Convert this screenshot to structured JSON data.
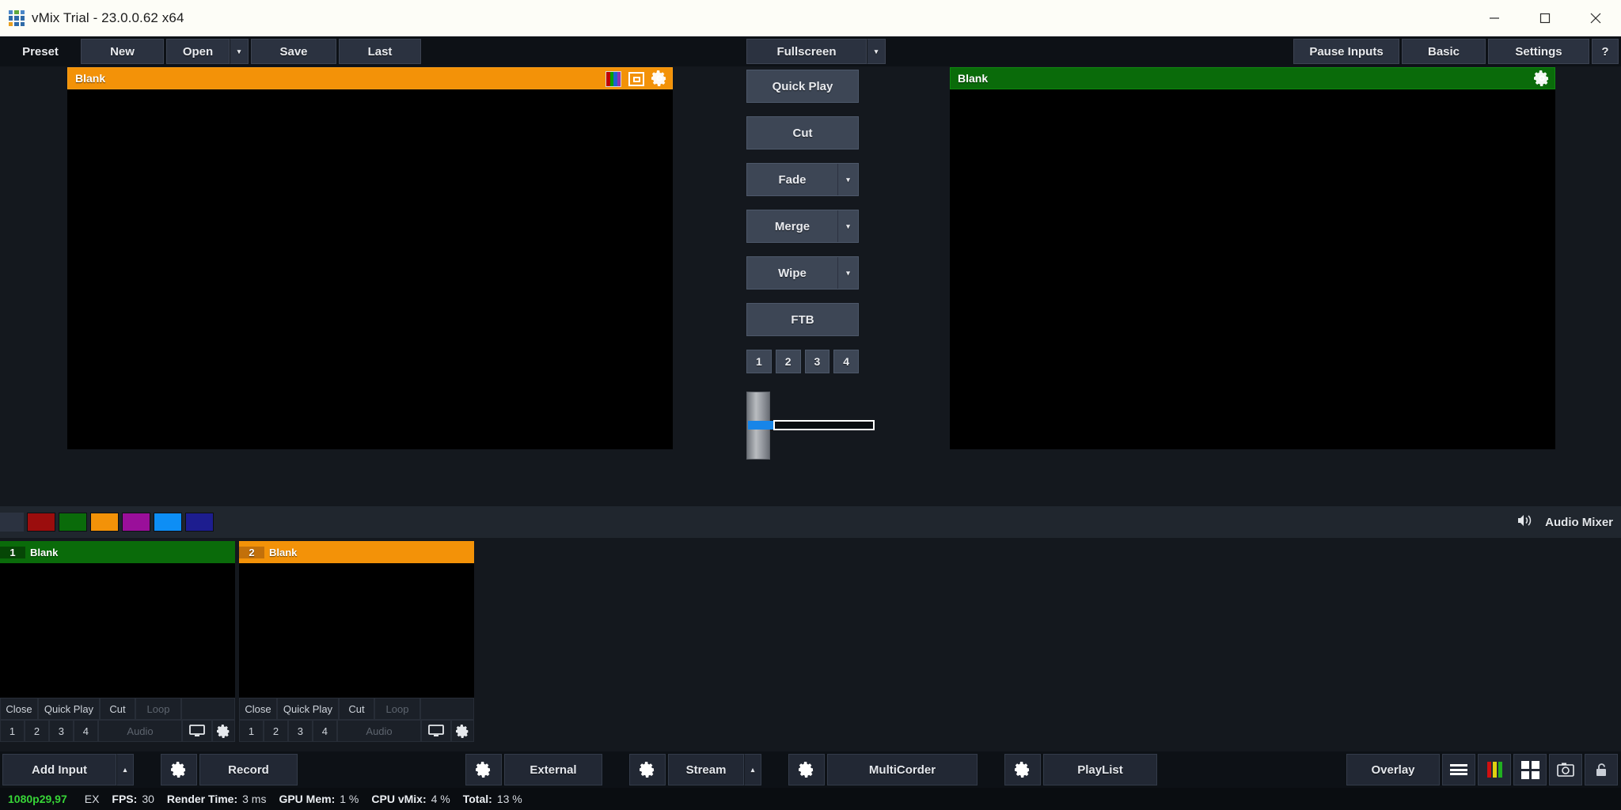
{
  "window": {
    "title": "vMix Trial - 23.0.0.62 x64",
    "logo_colors": [
      "#4a86c8",
      "#5fa83d",
      "#4a86c8",
      "#2f6ba8",
      "#2f6ba8",
      "#2f6ba8",
      "#e8a020",
      "#2f6ba8",
      "#2f6ba8"
    ],
    "controls": {
      "minimize": "minimize-icon",
      "maximize": "maximize-icon",
      "close": "close-icon"
    }
  },
  "toolbar": {
    "preset_label": "Preset",
    "new_label": "New",
    "open_label": "Open",
    "open_caret": "▾",
    "save_label": "Save",
    "last_label": "Last",
    "fullscreen_label": "Fullscreen",
    "fullscreen_caret": "▾",
    "pause_inputs_label": "Pause Inputs",
    "basic_label": "Basic",
    "settings_label": "Settings",
    "help_label": "?"
  },
  "preview": {
    "title": "Blank",
    "header_color": "#f39208",
    "icons": [
      "color-bars-icon",
      "pip-icon",
      "gear-icon"
    ],
    "bars_colors": [
      "#c00000",
      "#00a000",
      "#2060d0",
      "#9030b0"
    ]
  },
  "program": {
    "title": "Blank",
    "header_color": "#0a6b0a",
    "icons": [
      "gear-icon"
    ]
  },
  "transitions": {
    "quick_play": "Quick Play",
    "cut": "Cut",
    "fade": "Fade",
    "merge": "Merge",
    "wipe": "Wipe",
    "ftb": "FTB",
    "caret": "▾",
    "numbers": [
      "1",
      "2",
      "3",
      "4"
    ]
  },
  "tbar": {
    "position_percent": 0,
    "fill_color": "#1785e8"
  },
  "swatches": {
    "colors": [
      "#9b0d0d",
      "#0a6b0a",
      "#f39208",
      "#9a0f9a",
      "#0d8ef5",
      "#1d1d8f"
    ],
    "audio_mixer_label": "Audio Mixer",
    "audio_mixer_icon": "speaker-icon"
  },
  "inputs": [
    {
      "number": "1",
      "name": "Blank",
      "state": "program",
      "header_color": "#0a6b0a",
      "controls": [
        "Close",
        "Quick Play",
        "Cut",
        "Loop"
      ],
      "loop_disabled": true,
      "bus_buttons": [
        "1",
        "2",
        "3",
        "4"
      ],
      "audio_label": "Audio",
      "audio_disabled": true,
      "icons": [
        "monitor-icon",
        "gear-icon"
      ]
    },
    {
      "number": "2",
      "name": "Blank",
      "state": "preview",
      "header_color": "#f39208",
      "controls": [
        "Close",
        "Quick Play",
        "Cut",
        "Loop"
      ],
      "loop_disabled": true,
      "bus_buttons": [
        "1",
        "2",
        "3",
        "4"
      ],
      "audio_label": "Audio",
      "audio_disabled": true,
      "icons": [
        "monitor-icon",
        "gear-icon"
      ]
    }
  ],
  "bottombar": {
    "add_input_label": "Add Input",
    "add_input_caret": "▴",
    "record_label": "Record",
    "external_label": "External",
    "stream_label": "Stream",
    "stream_caret": "▴",
    "multicorder_label": "MultiCorder",
    "playlist_label": "PlayList",
    "overlay_label": "Overlay",
    "right_icons": [
      "list-icon",
      "audio-meter-icon",
      "grid-icon",
      "snapshot-icon",
      "lock-icon"
    ],
    "meter_colors": [
      "#d01010",
      "#e0d010",
      "#20b020"
    ]
  },
  "statusbar": {
    "resolution": "1080p29,97",
    "ex": "EX",
    "items": [
      {
        "label": "FPS:",
        "value": "30"
      },
      {
        "label": "Render Time:",
        "value": "3 ms"
      },
      {
        "label": "GPU Mem:",
        "value": "1 %"
      },
      {
        "label": "CPU vMix:",
        "value": "4 %"
      },
      {
        "label": "Total:",
        "value": "13 %"
      }
    ]
  }
}
